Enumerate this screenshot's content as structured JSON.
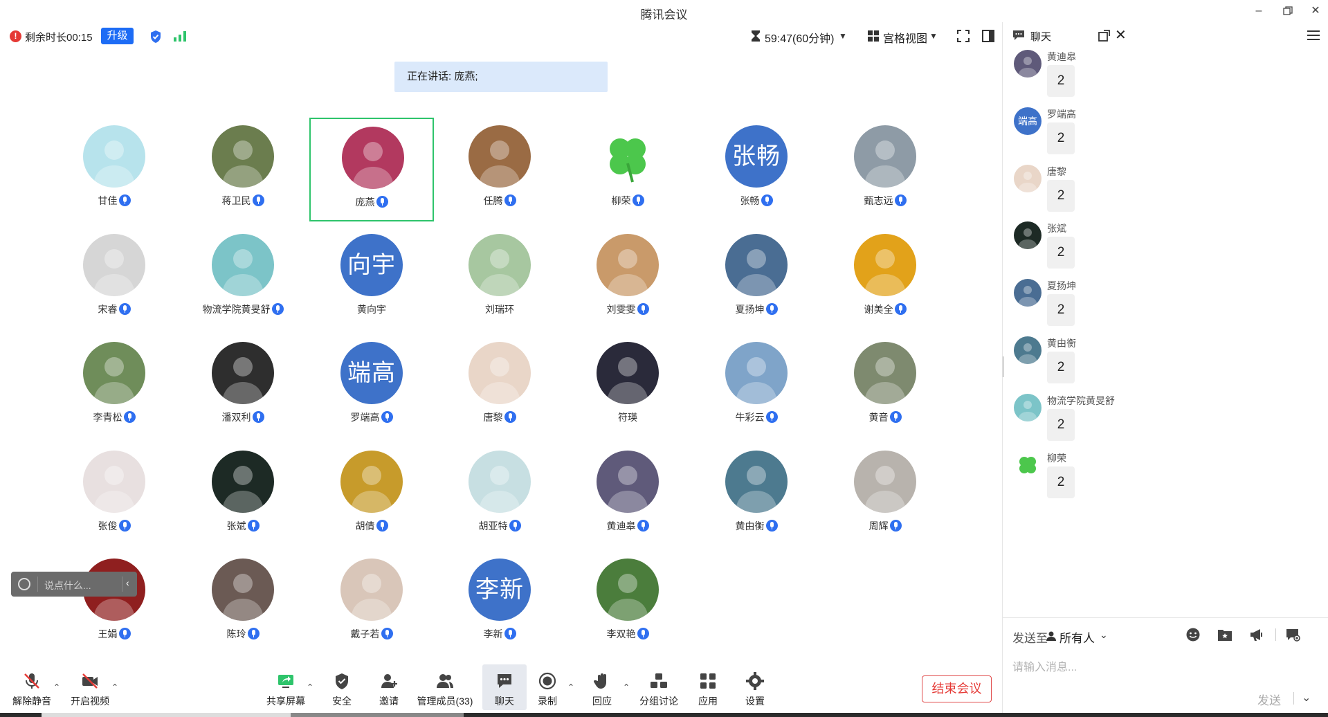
{
  "window": {
    "title": "腾讯会议",
    "minimize_icon": "minimize-icon",
    "restore_icon": "restore-icon",
    "close_icon": "close-icon"
  },
  "topbar": {
    "remaining": "剩余时长00:15",
    "upgrade": "升级",
    "timer": "59:47(60分钟)",
    "view_mode": "宫格视图"
  },
  "speaking": "正在讲话: 庞燕;",
  "participants": [
    {
      "name": "甘佳",
      "mic": true,
      "avatar_color": "#b7e3ec"
    },
    {
      "name": "蒋卫民",
      "mic": true,
      "avatar_color": "#6b7d4e"
    },
    {
      "name": "庞燕",
      "mic": true,
      "avatar_color": "#b2395f",
      "active": true
    },
    {
      "name": "任腾",
      "mic": true,
      "avatar_color": "#9a6b44"
    },
    {
      "name": "柳荣",
      "mic": true,
      "avatar_color": "#ffffff",
      "clover": true
    },
    {
      "name": "张畅",
      "mic": true,
      "avatar_text": "张畅"
    },
    {
      "name": "甄志远",
      "mic": true,
      "avatar_color": "#8e9ba6"
    },
    {
      "name": "宋睿",
      "mic": true,
      "avatar_color": "#d6d6d6"
    },
    {
      "name": "物流学院黄旻舒",
      "mic": true,
      "avatar_color": "#7cc4c8"
    },
    {
      "name": "黄向宇",
      "mic": false,
      "avatar_text": "向宇"
    },
    {
      "name": "刘瑞环",
      "mic": false,
      "avatar_color": "#a7c7a0"
    },
    {
      "name": "刘雯雯",
      "mic": true,
      "avatar_color": "#c99a6a"
    },
    {
      "name": "夏扬坤",
      "mic": true,
      "avatar_color": "#4a6d93"
    },
    {
      "name": "谢美全",
      "mic": true,
      "avatar_color": "#e2a21a"
    },
    {
      "name": "李青松",
      "mic": true,
      "avatar_color": "#6f8d5a"
    },
    {
      "name": "潘双利",
      "mic": true,
      "avatar_color": "#2e2e2e"
    },
    {
      "name": "罗端高",
      "mic": true,
      "avatar_text": "端高"
    },
    {
      "name": "唐黎",
      "mic": true,
      "avatar_color": "#e9d6c8"
    },
    {
      "name": "符瑛",
      "mic": false,
      "avatar_color": "#2a2a3a"
    },
    {
      "name": "牛彩云",
      "mic": true,
      "avatar_color": "#7fa4c9"
    },
    {
      "name": "黄音",
      "mic": true,
      "avatar_color": "#7e8a6f"
    },
    {
      "name": "张俊",
      "mic": true,
      "avatar_color": "#e8e0e0"
    },
    {
      "name": "张斌",
      "mic": true,
      "avatar_color": "#1d2a25"
    },
    {
      "name": "胡倩",
      "mic": true,
      "avatar_color": "#c79b2b"
    },
    {
      "name": "胡亚特",
      "mic": true,
      "avatar_color": "#c7dfe2"
    },
    {
      "name": "黄迪皋",
      "mic": true,
      "avatar_color": "#5f5a7a"
    },
    {
      "name": "黄由衡",
      "mic": true,
      "avatar_color": "#4d7a8f"
    },
    {
      "name": "周辉",
      "mic": true,
      "avatar_color": "#b8b3ad"
    },
    {
      "name": "王娟",
      "mic": true,
      "avatar_color": "#8f1f1f"
    },
    {
      "name": "陈玲",
      "mic": true,
      "avatar_color": "#6b5a54"
    },
    {
      "name": "戴子若",
      "mic": true,
      "avatar_color": "#d9c6b9"
    },
    {
      "name": "李新",
      "mic": true,
      "avatar_text": "李新"
    },
    {
      "name": "李双艳",
      "mic": true,
      "avatar_color": "#4b7d3c"
    }
  ],
  "saybox": {
    "placeholder": "说点什么...",
    "collapse": "‹"
  },
  "bottombar": {
    "unmute": "解除静音",
    "video": "开启视频",
    "share": "共享屏幕",
    "security": "安全",
    "invite": "邀请",
    "members": "管理成员(33)",
    "chat": "聊天",
    "record": "录制",
    "react": "回应",
    "breakout": "分组讨论",
    "apps": "应用",
    "settings": "设置",
    "end": "结束会议"
  },
  "chat": {
    "title": "聊天",
    "messages": [
      {
        "sender": "黄迪皋",
        "text": "2",
        "avatar_color": "#5f5a7a"
      },
      {
        "sender": "罗端高",
        "text": "2",
        "avatar_text": "端高"
      },
      {
        "sender": "唐黎",
        "text": "2",
        "avatar_color": "#e9d6c8"
      },
      {
        "sender": "张斌",
        "text": "2",
        "avatar_color": "#1d2a25"
      },
      {
        "sender": "夏扬坤",
        "text": "2",
        "avatar_color": "#4a6d93"
      },
      {
        "sender": "黄由衡",
        "text": "2",
        "avatar_color": "#4d7a8f"
      },
      {
        "sender": "物流学院黄旻舒",
        "text": "2",
        "avatar_color": "#7cc4c8"
      },
      {
        "sender": "柳荣",
        "text": "2",
        "avatar_color": "#ffffff",
        "clover": true
      }
    ],
    "send_to_label": "发送至",
    "send_to_value": "所有人",
    "input_placeholder": "请输入消息...",
    "send": "发送"
  },
  "colors": {
    "accent": "#1d6cf5",
    "avatar_blue": "#3e72c9",
    "active_border": "#2ec46b",
    "end_red": "#e53935"
  }
}
